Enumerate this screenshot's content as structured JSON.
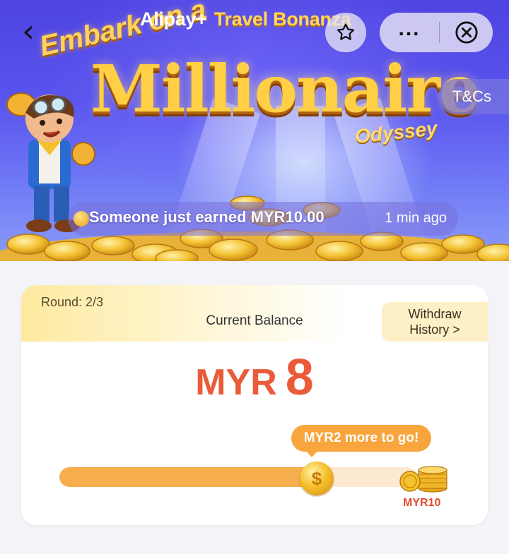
{
  "nav": {
    "back_glyph": "‹",
    "more_glyph": "...",
    "close_icon": "close-circle-icon",
    "favorite_icon": "star-icon"
  },
  "banner": {
    "brand_alipay": "Alipay+",
    "brand_event": "Travel Bonanza",
    "headline_line1": "Embark on a",
    "headline_main": "Millionaire",
    "headline_line3": "Odyssey",
    "tcs_label": "T&Cs",
    "ticker_message": "Someone just earned MYR10.00",
    "ticker_time": "1 min ago"
  },
  "balance_card": {
    "round_label": "Round: 2/3",
    "balance_label": "Current Balance",
    "withdraw_line1": "Withdraw",
    "withdraw_line2": "History >",
    "currency": "MYR",
    "amount": "8",
    "tooltip": "MYR2 more to go!",
    "coin_glyph": "$",
    "goal_label": "MYR10",
    "progress": 0.8
  },
  "colors": {
    "accent": "#ea5b3a",
    "progress_fill": "#f6ae4e",
    "progress_track": "#fde9d2",
    "tooltip": "#f7a53c",
    "banner": "#5a55ee"
  }
}
